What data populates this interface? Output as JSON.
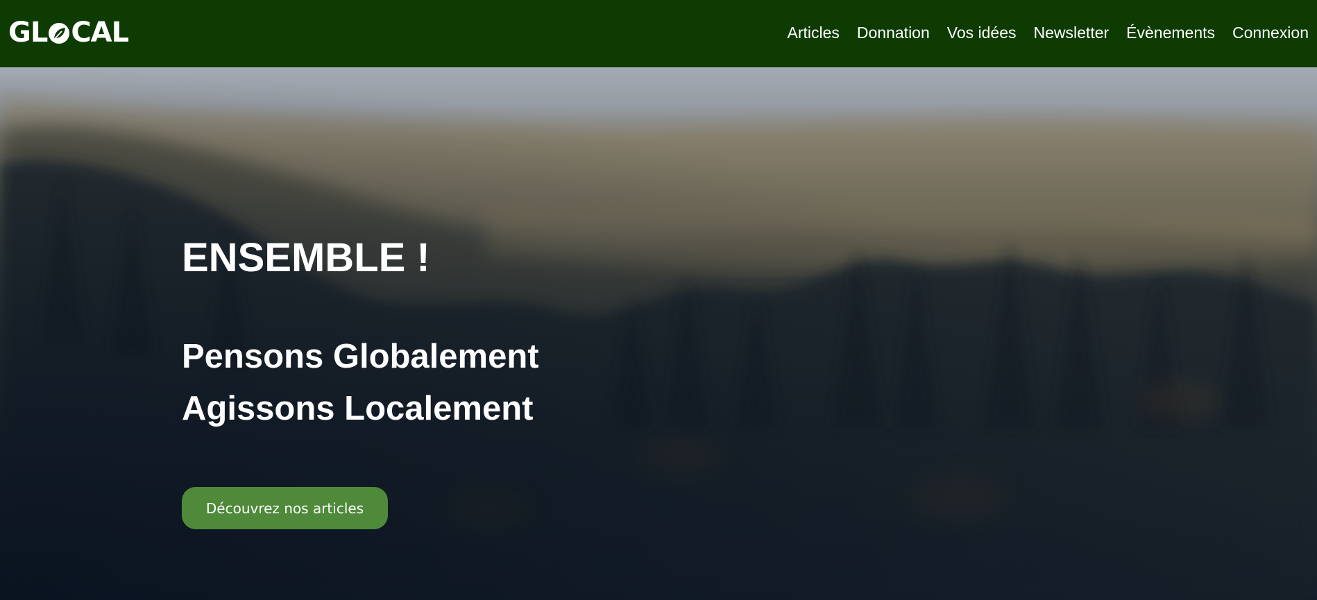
{
  "header": {
    "logo_text_left": "GL",
    "logo_text_right": "CAL",
    "nav": [
      {
        "label": "Articles"
      },
      {
        "label": "Donnation"
      },
      {
        "label": "Vos idées"
      },
      {
        "label": "Newsletter"
      },
      {
        "label": "Évènements"
      },
      {
        "label": "Connexion"
      }
    ],
    "background_color": "#0d3b02"
  },
  "hero": {
    "title": "ENSEMBLE !",
    "line1": "Pensons Globalement",
    "line2": "Agissons Localement",
    "cta_label": "Découvrez nos articles",
    "cta_color": "#4e8a3a",
    "background_image": "misty-forest"
  },
  "icons": {
    "logo_o": "leaf-icon"
  }
}
